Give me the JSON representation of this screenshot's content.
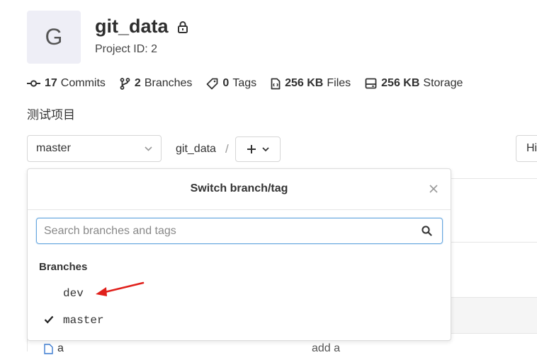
{
  "project": {
    "avatar_letter": "G",
    "name": "git_data",
    "id_text": "Project ID: 2",
    "visibility_icon": "lock-icon",
    "description": "测试项目"
  },
  "stats": {
    "commits": {
      "count": "17",
      "label": "Commits",
      "icon": "commit-icon"
    },
    "branches": {
      "count": "2",
      "label": "Branches",
      "icon": "branch-icon"
    },
    "tags": {
      "count": "0",
      "label": "Tags",
      "icon": "tag-icon"
    },
    "files": {
      "count": "256 KB",
      "label": "Files",
      "icon": "file-icon"
    },
    "storage": {
      "count": "256 KB",
      "label": "Storage",
      "icon": "storage-icon"
    }
  },
  "toolbar": {
    "selected_branch": "master",
    "breadcrumb": "git_data",
    "separator": "/",
    "history_partial": "Hi"
  },
  "dropdown": {
    "title": "Switch branch/tag",
    "search_placeholder": "Search branches and tags",
    "section_label": "Branches",
    "items": [
      {
        "label": "dev",
        "checked": false
      },
      {
        "label": "master",
        "checked": true
      }
    ]
  },
  "background_table": {
    "file_name": "a",
    "commit_message": "add a"
  },
  "colors": {
    "annotation_arrow": "#e0201b",
    "search_focus": "#6aa9e0",
    "avatar_bg": "#eeeef6"
  }
}
